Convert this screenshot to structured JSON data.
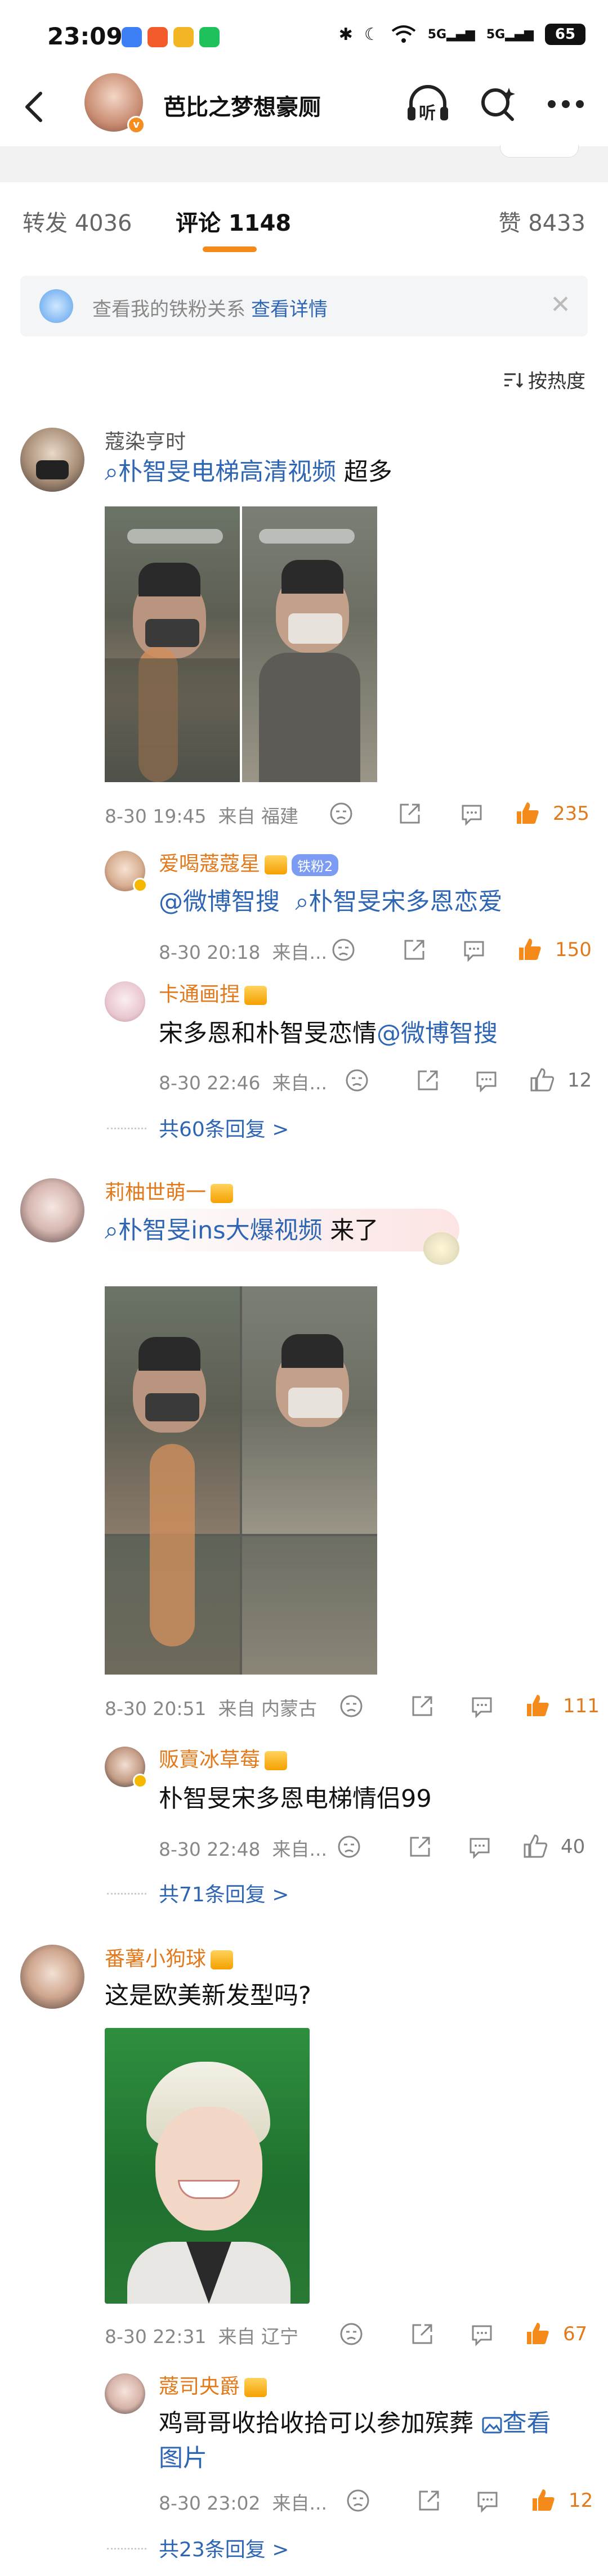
{
  "status_bar": {
    "time": "23:09",
    "battery": "65",
    "signal_labels": [
      "5G",
      "5G"
    ]
  },
  "nav": {
    "title": "芭比之梦想豪厕",
    "avatar_badge": "v",
    "listen_label": "听"
  },
  "tabs": {
    "repost": "转发 4036",
    "comment": "评论 1148",
    "like": "赞 8433"
  },
  "fan_banner": {
    "text": "查看我的铁粉关系",
    "link": "查看详情"
  },
  "sort": {
    "label": "按热度"
  },
  "comments": [
    {
      "username": "蔻染亨时",
      "search_link": "朴智旻电梯高清视频",
      "text_after": " 超多",
      "time": "8-30 19:45",
      "location": "来自 福建",
      "likes": "235",
      "replies": [
        {
          "username": "爱喝蔻蔻星",
          "iron_badge": "铁粉2",
          "mention": "@微博智搜",
          "search_link": "朴智旻宋多恩恋爱",
          "time": "8-30 20:18",
          "location": "来自...",
          "likes": "150"
        },
        {
          "username": "卡通画捏",
          "text": "宋多恩和朴智旻恋情",
          "mention": "@微博智搜",
          "time": "8-30 22:46",
          "location": "来自...",
          "likes": "12"
        }
      ],
      "more_replies": "共60条回复 >"
    },
    {
      "username": "莉柚世萌一",
      "search_link": "朴智旻ins大爆视频",
      "text_after": " 来了",
      "time": "8-30 20:51",
      "location": "来自 内蒙古",
      "likes": "111",
      "replies": [
        {
          "username": "贩賣冰草莓",
          "text": "朴智旻宋多恩电梯情侣99",
          "time": "8-30 22:48",
          "location": "来自...",
          "likes": "40"
        }
      ],
      "more_replies": "共71条回复 >"
    },
    {
      "username": "番薯小狗球",
      "text": "这是欧美新发型吗?",
      "time": "8-30 22:31",
      "location": "来自 辽宁",
      "likes": "67",
      "replies": [
        {
          "username": "蔻司央爵",
          "text": "鸡哥哥收拾收拾可以参加殡葬",
          "view_image_a": "查看",
          "view_image_b": "图片",
          "time": "8-30 23:02",
          "location": "来自...",
          "likes": "12"
        }
      ],
      "more_replies": "共23条回复 >"
    }
  ],
  "colors": {
    "accent": "#f48a1a",
    "link": "#2f66b4",
    "orange_name": "#e2791a"
  }
}
